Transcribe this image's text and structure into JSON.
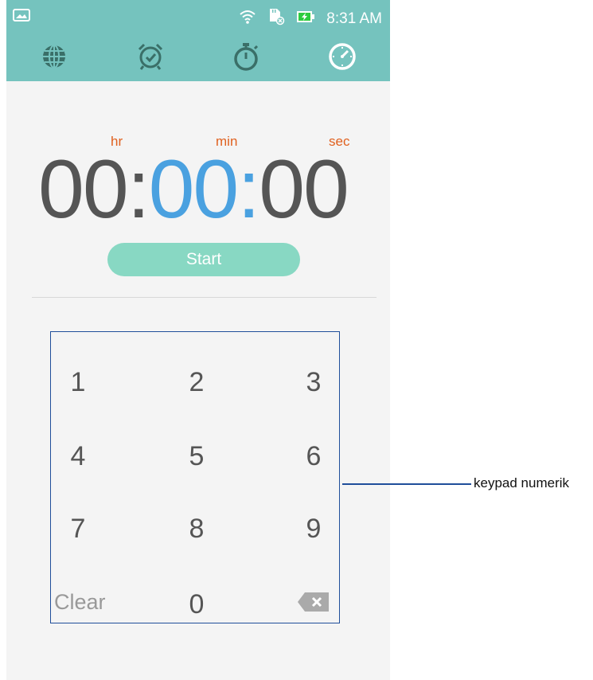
{
  "status_bar": {
    "time": "8:31 AM",
    "background_color": "#75c3be",
    "icons": [
      "image-icon",
      "wifi-icon",
      "sdcard-icon",
      "battery-charging-icon"
    ]
  },
  "tabs": [
    {
      "name": "world-clock",
      "icon": "globe-icon"
    },
    {
      "name": "alarm",
      "icon": "alarm-clock-icon"
    },
    {
      "name": "stopwatch",
      "icon": "stopwatch-icon"
    },
    {
      "name": "timer",
      "icon": "timer-icon",
      "selected": true
    }
  ],
  "timer": {
    "hr_label": "hr",
    "min_label": "min",
    "sec_label": "sec",
    "hours": "00",
    "minutes": "00",
    "seconds": "00",
    "separator": ":",
    "unit_color": "#e0611f",
    "active_color": "#4aa1e0"
  },
  "start_button": {
    "label": "Start",
    "color": "#88d8c3"
  },
  "keypad": {
    "keys": [
      "1",
      "2",
      "3",
      "4",
      "5",
      "6",
      "7",
      "8",
      "9"
    ],
    "clear_label": "Clear",
    "zero_label": "0",
    "backspace_icon": "backspace-icon"
  },
  "annotation": {
    "label": "keypad numerik",
    "color": "#1f4e9a"
  }
}
